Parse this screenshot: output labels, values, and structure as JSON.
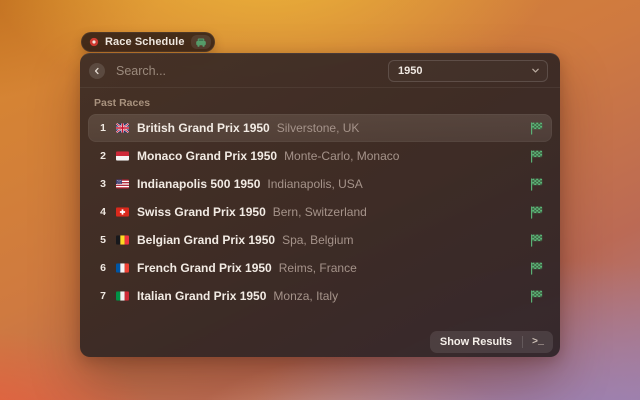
{
  "badge": {
    "title": "Race Schedule",
    "left_icon": "record-icon",
    "right_icon": "car-icon"
  },
  "header": {
    "back_icon": "chevron-left-icon",
    "search_placeholder": "Search...",
    "year_dropdown": {
      "value": "1950",
      "icon": "chevron-down-icon"
    }
  },
  "section": {
    "title": "Past Races"
  },
  "races": [
    {
      "position": "1",
      "flag": "uk",
      "name": "British Grand Prix 1950",
      "location": "Silverstone, UK",
      "status_icon": "checkered-flag-icon",
      "selected": true
    },
    {
      "position": "2",
      "flag": "monaco",
      "name": "Monaco Grand Prix 1950",
      "location": "Monte-Carlo, Monaco",
      "status_icon": "checkered-flag-icon",
      "selected": false
    },
    {
      "position": "3",
      "flag": "usa",
      "name": "Indianapolis 500 1950",
      "location": "Indianapolis, USA",
      "status_icon": "checkered-flag-icon",
      "selected": false
    },
    {
      "position": "4",
      "flag": "switzerland",
      "name": "Swiss Grand Prix 1950",
      "location": "Bern, Switzerland",
      "status_icon": "checkered-flag-icon",
      "selected": false
    },
    {
      "position": "5",
      "flag": "belgium",
      "name": "Belgian Grand Prix 1950",
      "location": "Spa, Belgium",
      "status_icon": "checkered-flag-icon",
      "selected": false
    },
    {
      "position": "6",
      "flag": "france",
      "name": "French Grand Prix 1950",
      "location": "Reims, France",
      "status_icon": "checkered-flag-icon",
      "selected": false
    },
    {
      "position": "7",
      "flag": "italy",
      "name": "Italian Grand Prix 1950",
      "location": "Monza, Italy",
      "status_icon": "checkered-flag-icon",
      "selected": false
    }
  ],
  "footer": {
    "show_results_label": "Show Results",
    "terminal_label": ">_"
  },
  "colors": {
    "accent_green": "#5cb87a",
    "badge_red": "#d23b31",
    "panel_brown": "#3e2e26"
  }
}
